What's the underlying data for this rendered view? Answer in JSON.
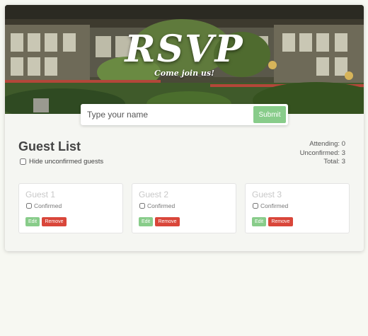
{
  "hero": {
    "title": "RSVP",
    "subtitle": "Come join us!"
  },
  "form": {
    "placeholder": "Type your name",
    "submit_label": "Submit"
  },
  "guest_list": {
    "title": "Guest List",
    "hide_label": "Hide unconfirmed guests",
    "hide_checked": false
  },
  "stats": {
    "attending": "Attending: 0",
    "unconfirmed": "Unconfirmed: 3",
    "total": "Total: 3"
  },
  "guests": [
    {
      "name": "Guest 1",
      "confirmed_label": "Confirmed",
      "edit_label": "Edit",
      "remove_label": "Remove"
    },
    {
      "name": "Guest 2",
      "confirmed_label": "Confirmed",
      "edit_label": "Edit",
      "remove_label": "Remove"
    },
    {
      "name": "Guest 3",
      "confirmed_label": "Confirmed",
      "edit_label": "Edit",
      "remove_label": "Remove"
    }
  ],
  "colors": {
    "accent_green": "#88cc8a",
    "danger_red": "#d9463a",
    "page_bg": "#f7f8f2"
  }
}
